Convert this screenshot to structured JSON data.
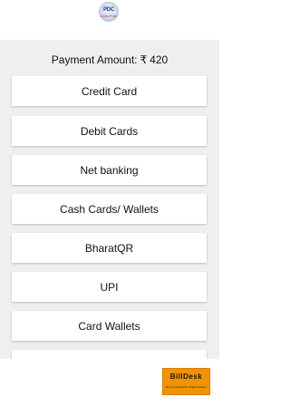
{
  "header": {
    "logo_text": "PDC",
    "logo_sub": "India Post"
  },
  "payment": {
    "label": "Payment Amount:",
    "currency": "₹",
    "amount": "420"
  },
  "options": [
    {
      "label": "Credit Card"
    },
    {
      "label": "Debit Cards"
    },
    {
      "label": "Net banking"
    },
    {
      "label": "Cash Cards/ Wallets"
    },
    {
      "label": "BharatQR"
    },
    {
      "label": "UPI"
    },
    {
      "label": "Card Wallets"
    },
    {
      "label": "..."
    }
  ],
  "footer": {
    "brand": "BillDesk",
    "tagline": "All your payments. Single location."
  },
  "colors": {
    "background": "#efefef",
    "option_bg": "#ffffff",
    "billdesk_orange": "#f39200"
  }
}
